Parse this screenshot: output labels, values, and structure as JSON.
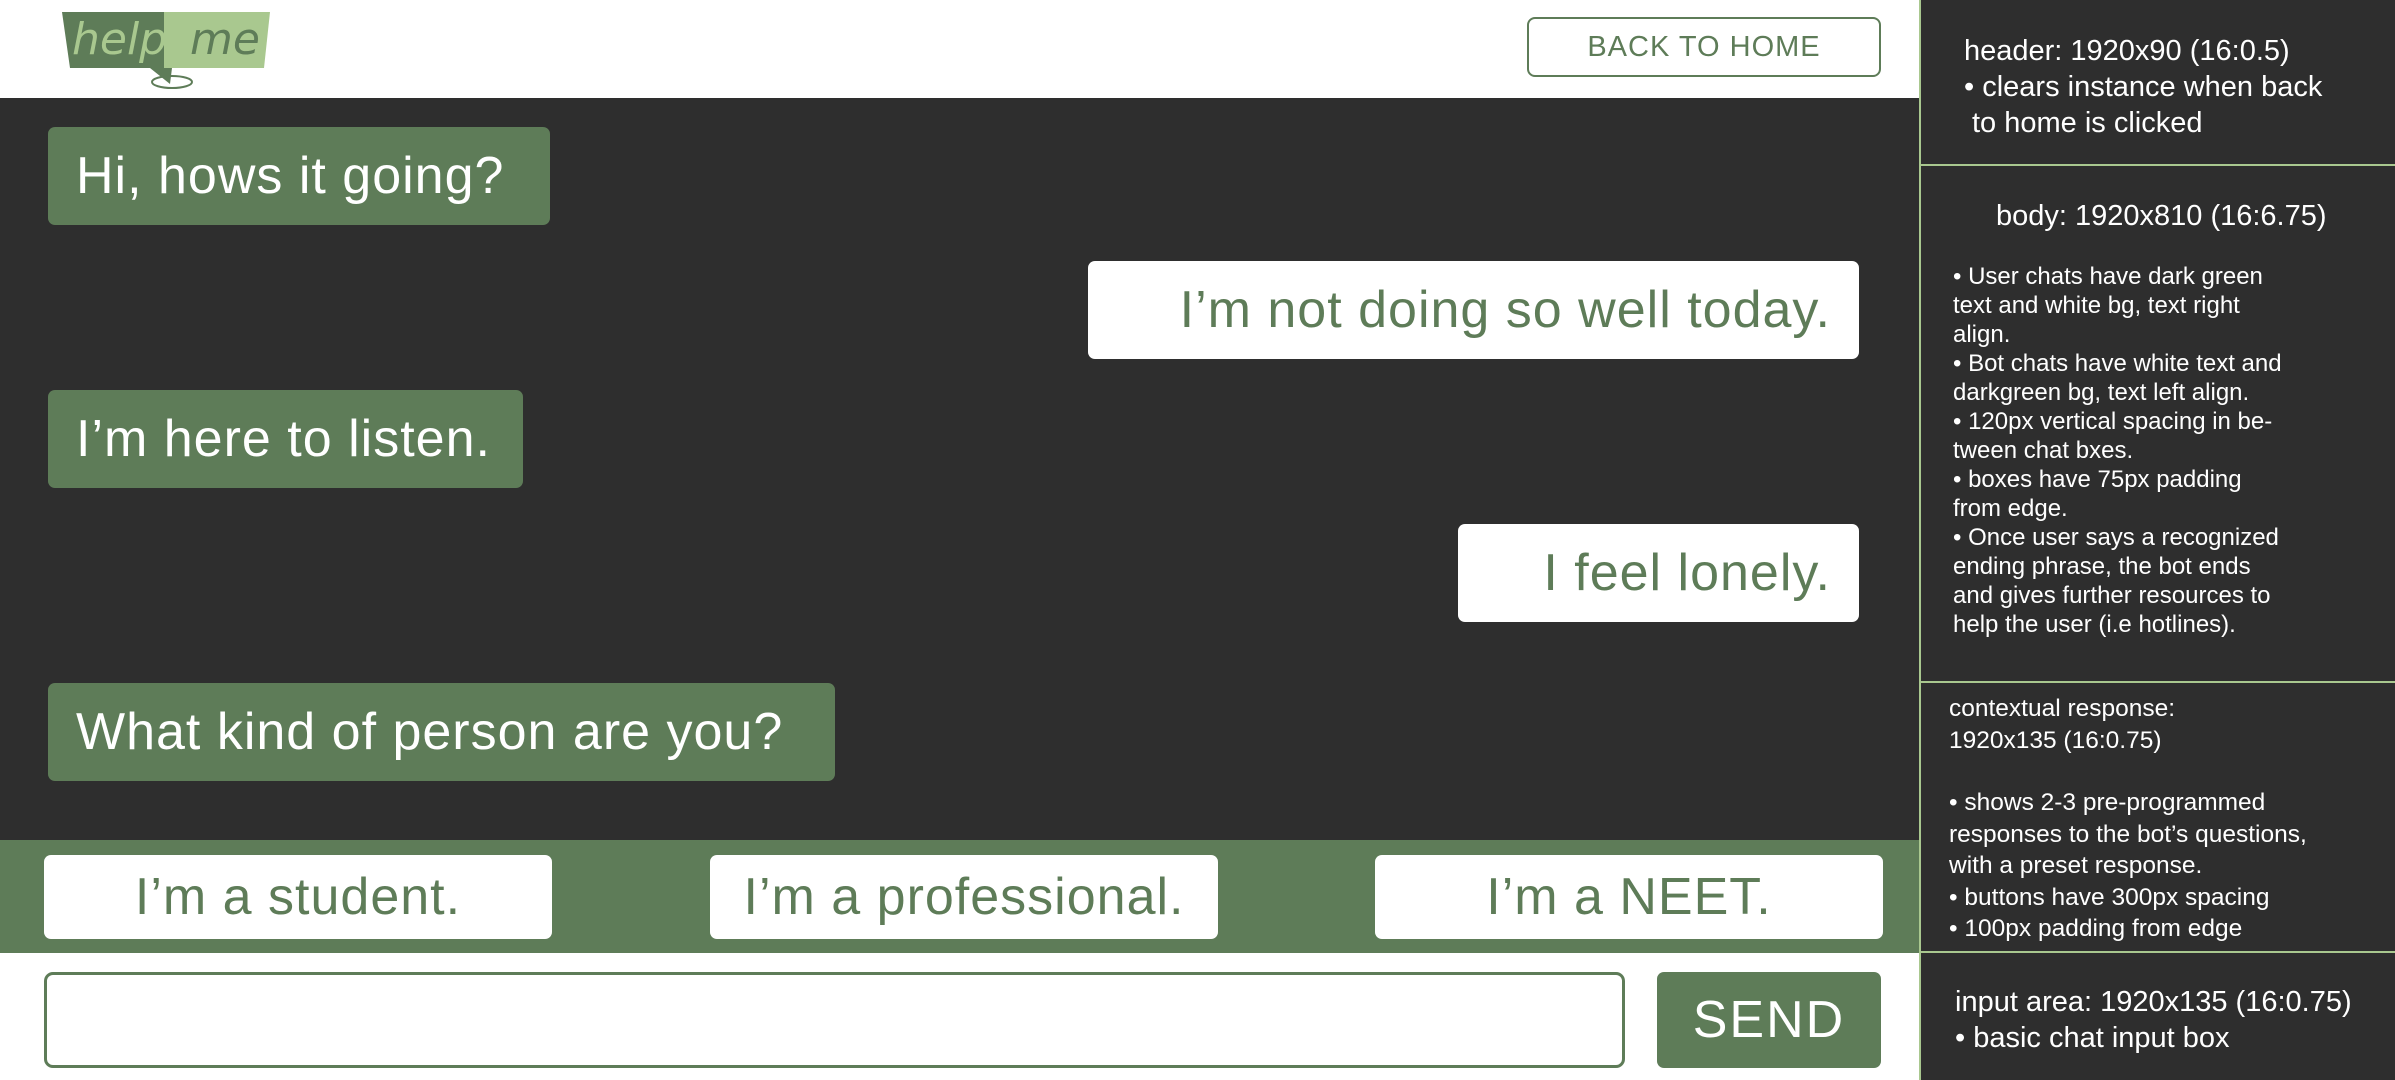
{
  "header": {
    "logo": {
      "help_text": "help",
      "me_text": "me"
    },
    "back_button": "BACK TO HOME"
  },
  "chat": {
    "messages": [
      {
        "sender": "bot",
        "text": "Hi, hows it going?"
      },
      {
        "sender": "user",
        "text": "I’m not doing so well today."
      },
      {
        "sender": "bot",
        "text": "I’m here to listen."
      },
      {
        "sender": "user",
        "text": "I feel lonely."
      },
      {
        "sender": "bot",
        "text": "What kind of person are you?"
      }
    ]
  },
  "contextual_responses": [
    "I’m a student.",
    "I’m a professional.",
    "I’m a NEET."
  ],
  "input": {
    "value": "",
    "placeholder": "",
    "send_label": "SEND"
  },
  "annotations": {
    "header": {
      "title": "header: 1920x90 (16:0.5)",
      "lines": [
        "• clears instance when back",
        "to home is clicked"
      ]
    },
    "body": {
      "title": "body: 1920x810 (16:6.75)",
      "lines": [
        "• User chats have dark green",
        "text and white bg, text right",
        "align.",
        "• Bot chats have white text and",
        "darkgreen bg, text left align.",
        "• 120px vertical spacing in be-",
        "tween chat bxes.",
        "• boxes have 75px padding",
        "from edge.",
        "•  Once user says a recognized",
        "ending phrase, the bot ends",
        "and gives further resources to",
        "help the user (i.e hotlines)."
      ]
    },
    "contextual": {
      "title_lines": [
        "contextual response:",
        "1920x135 (16:0.75)"
      ],
      "lines": [
        "•  shows 2-3 pre-programmed",
        "responses to the bot’s questions,",
        "with a preset response.",
        "•  buttons have 300px spacing",
        "•  100px padding from edge"
      ]
    },
    "input_area": {
      "title": "input area:  1920x135 (16:0.75)",
      "lines": [
        "•  basic chat input box"
      ]
    }
  },
  "colors": {
    "dark_green": "#5e7c58",
    "light_green": "#a9c88f",
    "dark_bg": "#2e2e2e",
    "white": "#ffffff"
  }
}
